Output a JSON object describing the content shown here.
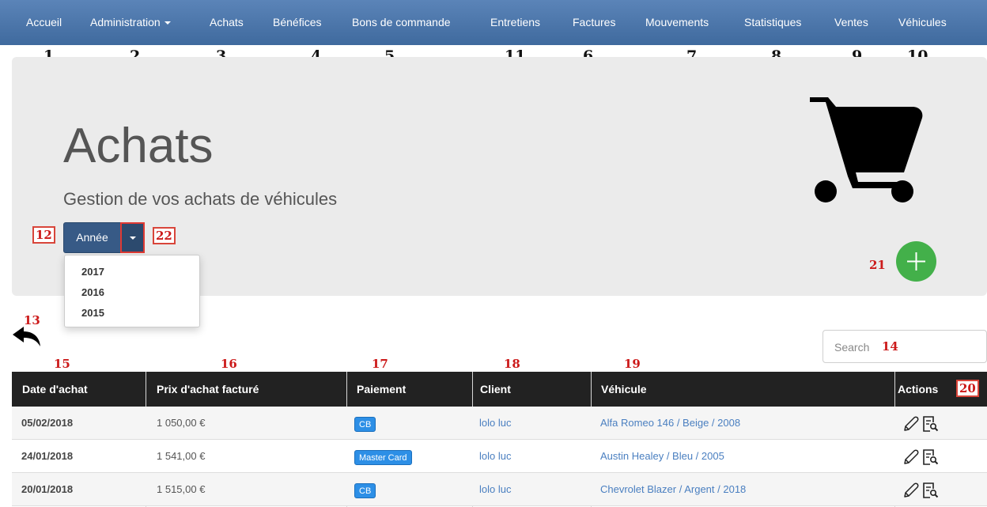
{
  "nav": {
    "items": [
      {
        "label": "Accueil"
      },
      {
        "label": "Administration"
      },
      {
        "label": "Achats"
      },
      {
        "label": "Bénéfices"
      },
      {
        "label": "Bons de commande"
      },
      {
        "label": "Entretiens"
      },
      {
        "label": "Factures"
      },
      {
        "label": "Mouvements"
      },
      {
        "label": "Statistiques"
      },
      {
        "label": "Ventes"
      },
      {
        "label": "Véhicules"
      }
    ],
    "markers": [
      "1",
      "2",
      "3",
      "4",
      "5",
      "11",
      "6",
      "7",
      "8",
      "9",
      "10"
    ]
  },
  "page": {
    "title": "Achats",
    "subtitle": "Gestion de vos achats de véhicules"
  },
  "year_filter": {
    "label": "Année",
    "options": [
      "2017",
      "2016",
      "2015"
    ]
  },
  "search": {
    "placeholder": "Search"
  },
  "table": {
    "headers": [
      "Date d'achat",
      "Prix d'achat facturé",
      "Paiement",
      "Client",
      "Véhicule",
      "Actions"
    ],
    "rows": [
      {
        "date": "05/02/2018",
        "price": "1 050,00 €",
        "payment": "CB",
        "client": "lolo luc",
        "vehicle": "Alfa Romeo 146 / Beige / 2008"
      },
      {
        "date": "24/01/2018",
        "price": "1 541,00 €",
        "payment": "Master Card",
        "client": "lolo luc",
        "vehicle": "Austin Healey / Bleu / 2005"
      },
      {
        "date": "20/01/2018",
        "price": "1 515,00 €",
        "payment": "CB",
        "client": "lolo luc",
        "vehicle": "Chevrolet Blazer / Argent / 2018"
      }
    ]
  },
  "annotations": {
    "annee_button": "12",
    "dropdown_toggle": "22",
    "back": "13",
    "search": "14",
    "col_date": "15",
    "col_price": "16",
    "col_payment": "17",
    "col_client": "18",
    "col_vehicle": "19",
    "col_actions": "20",
    "add": "21"
  },
  "colors": {
    "navbar": "#4a74a8",
    "primary_button": "#375a86",
    "add_button": "#43b04a",
    "badge": "#2d8fe6",
    "link": "#4a7fc0",
    "table_header": "#222222",
    "annotation_red": "#cc1a1a"
  },
  "icons": [
    "cart-icon",
    "plus-icon",
    "back-arrow-icon",
    "pencil-icon",
    "magnify-doc-icon",
    "caret-down-icon"
  ]
}
